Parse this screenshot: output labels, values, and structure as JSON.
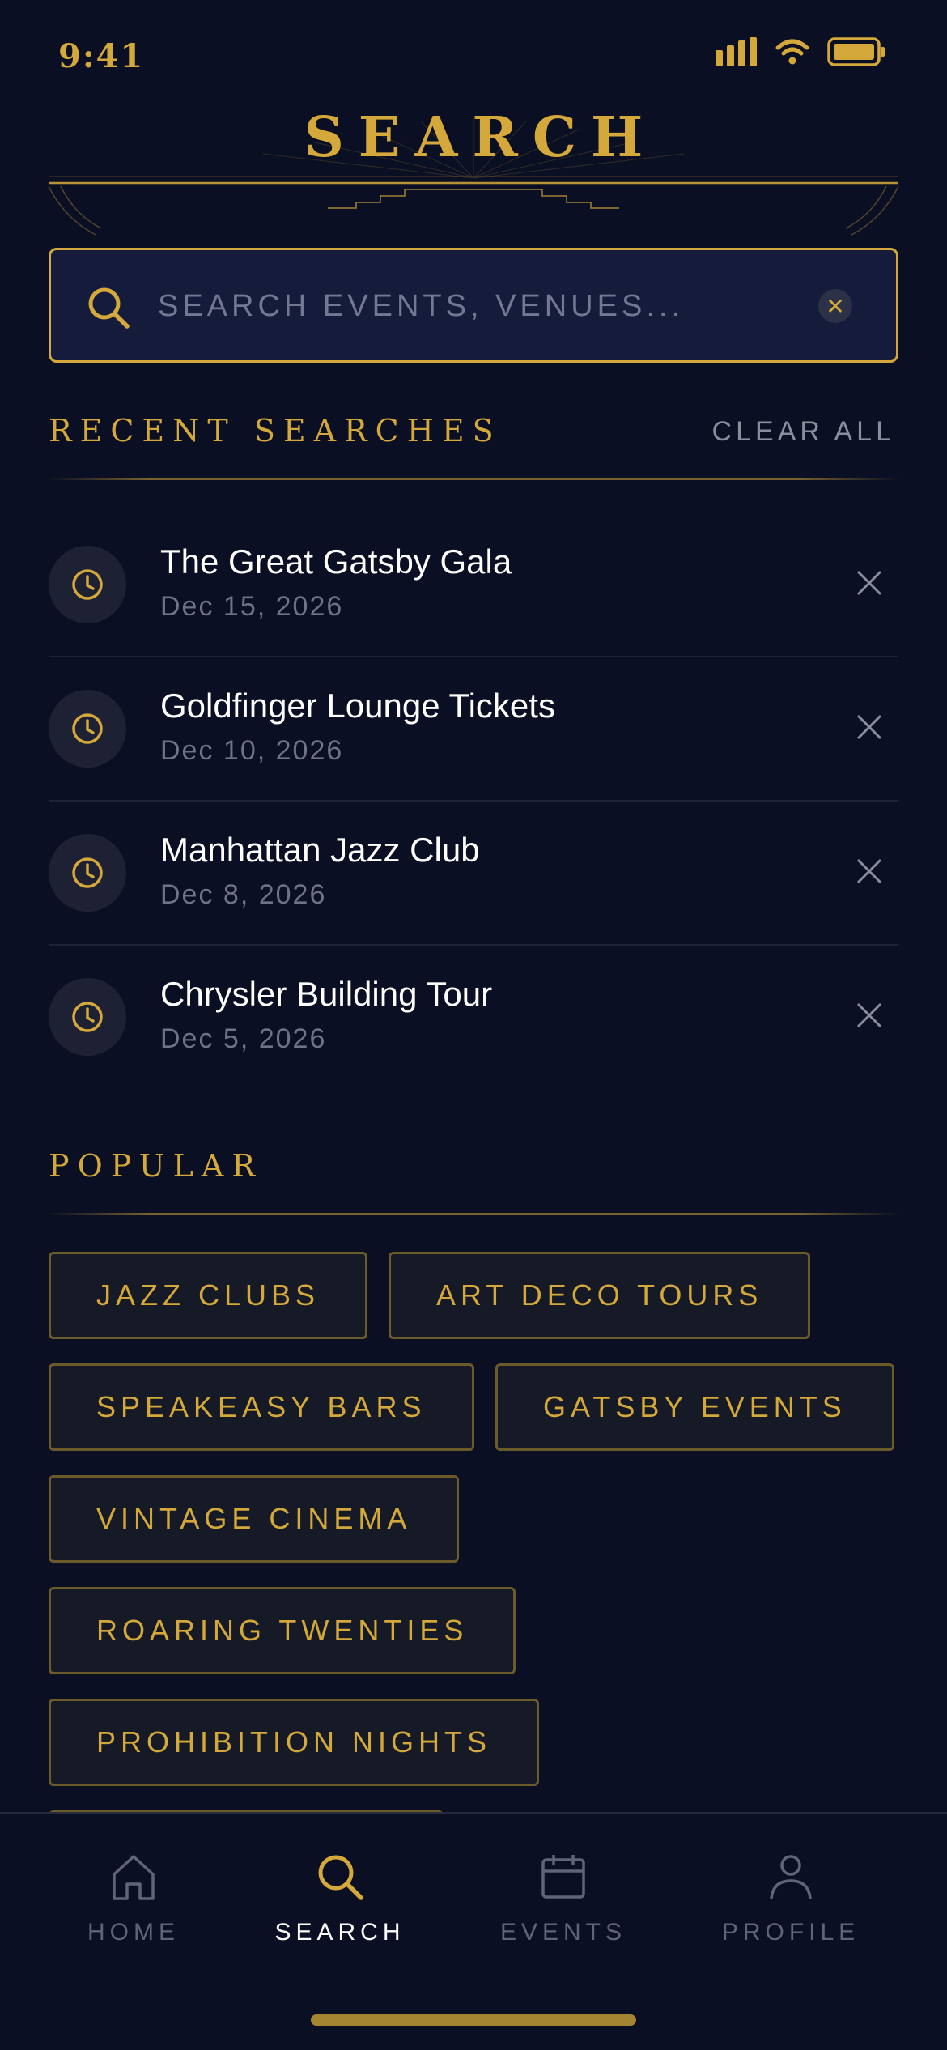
{
  "status_bar": {
    "time": "9:41"
  },
  "header": {
    "title": "SEARCH"
  },
  "search": {
    "placeholder": "SEARCH EVENTS, VENUES...",
    "value": ""
  },
  "recent": {
    "heading": "RECENT SEARCHES",
    "clear_label": "CLEAR ALL",
    "items": [
      {
        "title": "The Great Gatsby Gala",
        "date": "Dec 15, 2026"
      },
      {
        "title": "Goldfinger Lounge Tickets",
        "date": "Dec 10, 2026"
      },
      {
        "title": "Manhattan Jazz Club",
        "date": "Dec 8, 2026"
      },
      {
        "title": "Chrysler Building Tour",
        "date": "Dec 5, 2026"
      }
    ]
  },
  "popular": {
    "heading": "POPULAR",
    "chips": [
      "JAZZ CLUBS",
      "ART DECO TOURS",
      "SPEAKEASY BARS",
      "GATSBY EVENTS",
      "VINTAGE CINEMA",
      "ROARING TWENTIES",
      "PROHIBITION NIGHTS"
    ]
  },
  "tabbar": {
    "tabs": [
      {
        "label": "HOME",
        "icon": "home-icon",
        "active": false
      },
      {
        "label": "SEARCH",
        "icon": "search-icon",
        "active": true
      },
      {
        "label": "EVENTS",
        "icon": "calendar-icon",
        "active": false
      },
      {
        "label": "PROFILE",
        "icon": "user-icon",
        "active": false
      }
    ]
  },
  "colors": {
    "background": "#0b0f23",
    "accent": "#d4a83a",
    "muted": "#6e7387",
    "panel": "#141b3b"
  }
}
